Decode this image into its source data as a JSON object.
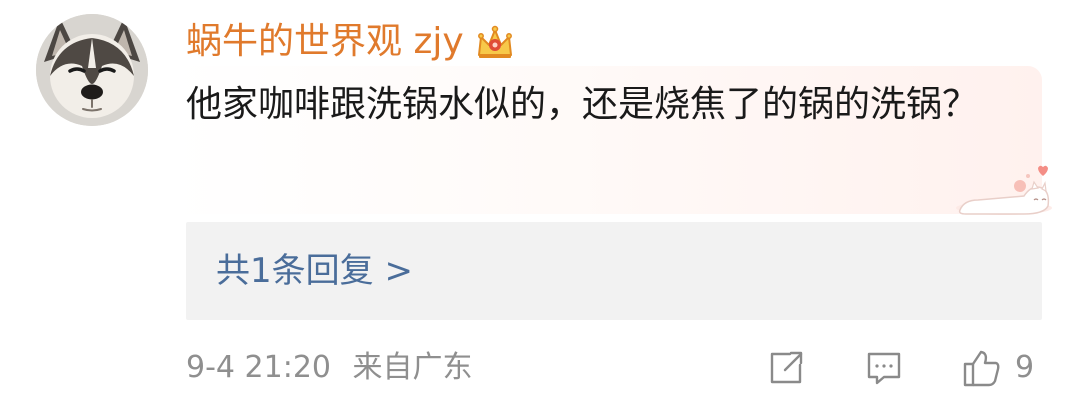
{
  "comment": {
    "username": "蜗牛的世界观 zjy",
    "text": "他家咖啡跟洗锅水似的，还是烧焦了的锅的洗锅？"
  },
  "replies": {
    "link_text": "共1条回复 >"
  },
  "footer": {
    "timestamp": "9-4 21:20",
    "location": "来自广东",
    "like_count": "9"
  },
  "icons": {
    "avatar": "husky-avatar",
    "badge": "crown-icon",
    "sticker": "sleeping-cat-sticker",
    "share": "share-icon",
    "reply": "comment-icon",
    "like": "thumbs-up-icon"
  },
  "colors": {
    "username": "#e07a2c",
    "reply_link": "#4a6d9a",
    "meta": "#8f8f8f"
  }
}
